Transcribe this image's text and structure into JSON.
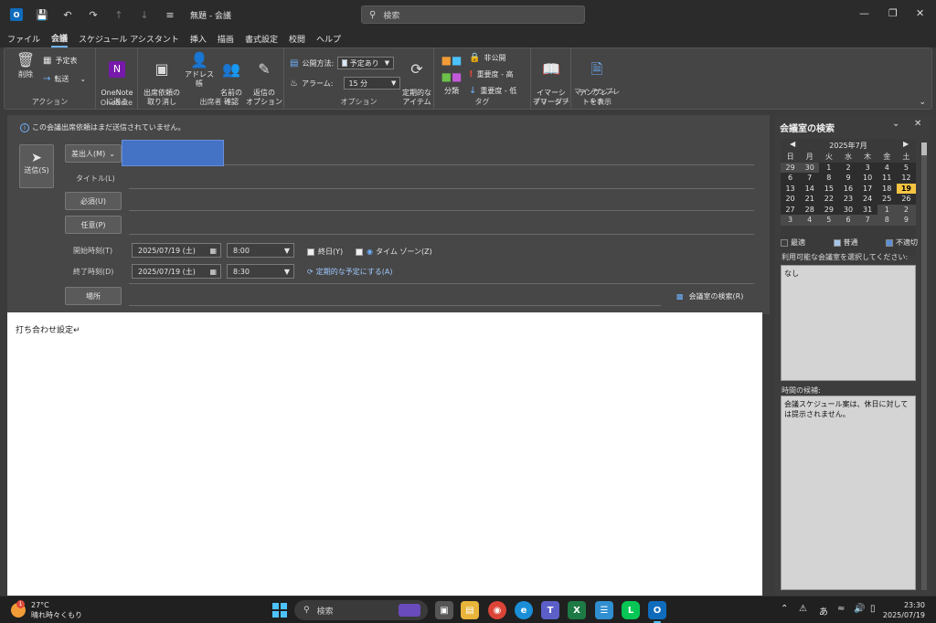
{
  "title_bar": {
    "title": "無題 - 会議",
    "search_placeholder": "検索"
  },
  "menu": {
    "tabs": [
      "ファイル",
      "会議",
      "スケジュール アシスタント",
      "挿入",
      "描画",
      "書式設定",
      "校閲",
      "ヘルプ"
    ],
    "active_tab": "会議"
  },
  "ribbon": {
    "groups": {
      "action": "アクション",
      "onenote": "OneNote",
      "attendees": "出席者",
      "options": "オプション",
      "tags": "タグ",
      "immersive": "イマーシブ",
      "my_templates": "マイ テンプレート"
    },
    "buttons": {
      "delete": "削除",
      "calendar": "予定表",
      "forward": "転送",
      "onenote_send": "OneNote\nに送る",
      "cancel_invitation": "出席依頼の\n取り消し",
      "address_book": "アドレス帳",
      "check_names": "名前の\n確認",
      "response_options": "返信の\nオプション",
      "show_as_label": "公開方法:",
      "show_as_value": "予定あり",
      "reminder_label": "アラーム:",
      "reminder_value": "15 分",
      "recurrence": "定期的な\nアイテム",
      "categorize": "分類",
      "private": "非公開",
      "high_importance": "重要度 - 高",
      "low_importance": "重要度 - 低",
      "immersive_reader": "イマーシ\nブリーダー",
      "view_templates": "テンプレー\nトを表示"
    }
  },
  "compose": {
    "info_message": "この会議出席依頼はまだ送信されていません。",
    "send_label": "送信(S)",
    "from_label": "差出人(M)",
    "title_label": "タイトル(L)",
    "required_label": "必須(U)",
    "optional_label": "任意(P)",
    "start_label": "開始時刻(T)",
    "end_label": "終了時刻(D)",
    "start_date": "2025/07/19 (土)",
    "start_time": "8:00",
    "end_date": "2025/07/19 (土)",
    "end_time": "8:30",
    "all_day_label": "終日(Y)",
    "timezone_label": "タイム ゾーン(Z)",
    "recurring_link": "定期的な予定にする(A)",
    "location_label": "場所",
    "room_finder_link": "会議室の検索(R)",
    "body_text": "打ち合わせ設定↵"
  },
  "room_finder": {
    "title": "会議室の検索",
    "month_title": "2025年7月",
    "weekdays": [
      "日",
      "月",
      "火",
      "水",
      "木",
      "金",
      "土"
    ],
    "days": [
      [
        "29",
        "30",
        "1",
        "2",
        "3",
        "4",
        "5"
      ],
      [
        "6",
        "7",
        "8",
        "9",
        "10",
        "11",
        "12"
      ],
      [
        "13",
        "14",
        "15",
        "16",
        "17",
        "18",
        "19"
      ],
      [
        "20",
        "21",
        "22",
        "23",
        "24",
        "25",
        "26"
      ],
      [
        "27",
        "28",
        "29",
        "30",
        "31",
        "1",
        "2"
      ],
      [
        "3",
        "4",
        "5",
        "6",
        "7",
        "8",
        "9"
      ]
    ],
    "today": "19",
    "legend": {
      "best": "最適",
      "good": "普通",
      "poor": "不適切"
    },
    "legend_colors": {
      "best": "#3d3d3d",
      "good": "#a7c7ea",
      "poor": "#5b8fd6"
    },
    "rooms_label": "利用可能な会議室を選択してください:",
    "rooms_value": "なし",
    "suggested_times_label": "時間の候補:",
    "suggested_times_text": "会議スケジュール案は、休日に対しては提示されません。"
  },
  "taskbar": {
    "weather_temp": "27°C",
    "weather_desc": "晴れ時々くもり",
    "weather_badge": "1",
    "search_placeholder": "検索",
    "ime": "あ",
    "time": "23:30",
    "date": "2025/07/19"
  }
}
